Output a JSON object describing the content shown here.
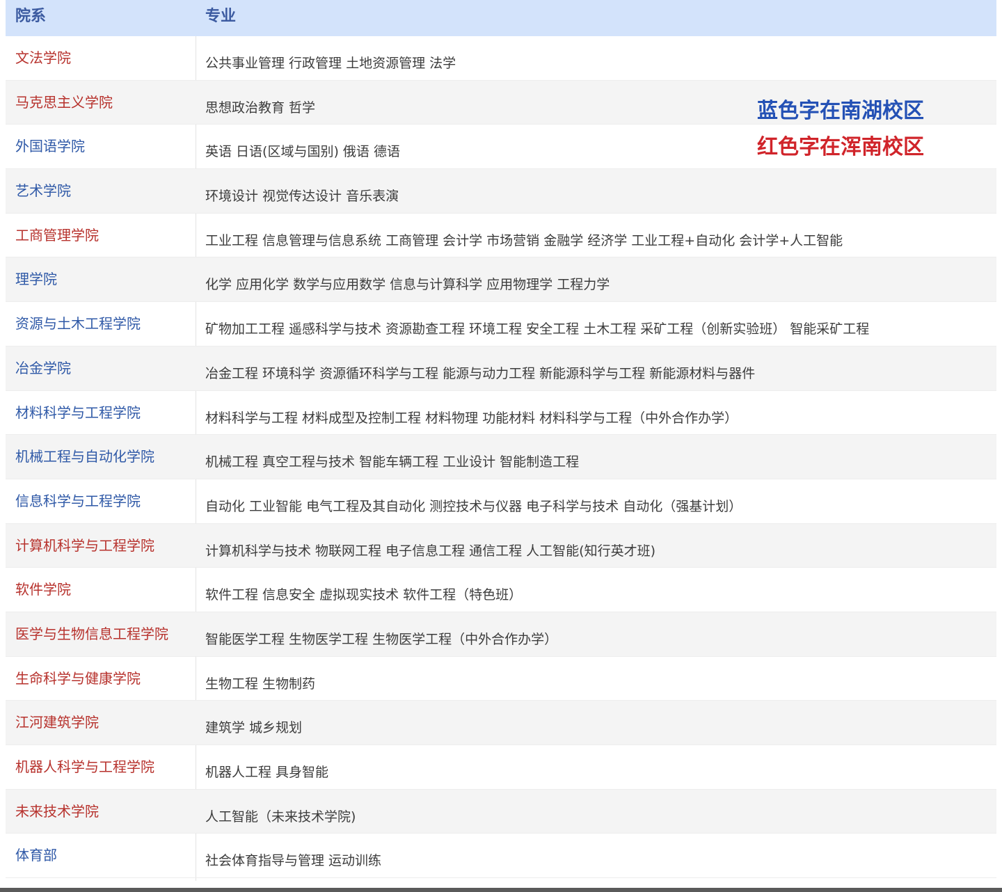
{
  "header": {
    "dept_label": "院系",
    "major_label": "专业"
  },
  "legend": {
    "blue_note": "蓝色字在南湖校区",
    "red_note": "红色字在浑南校区"
  },
  "colors": {
    "header_bg": "#d3e3fb",
    "red_campus": "#b7322d",
    "blue_campus": "#2f59a7"
  },
  "rows": [
    {
      "dept": "文法学院",
      "color": "red",
      "majors": "公共事业管理  行政管理  土地资源管理  法学"
    },
    {
      "dept": "马克思主义学院",
      "color": "red",
      "majors": "思想政治教育  哲学"
    },
    {
      "dept": "外国语学院",
      "color": "blue",
      "majors": "英语  日语(区域与国别)  俄语  德语"
    },
    {
      "dept": "艺术学院",
      "color": "blue",
      "majors": "环境设计  视觉传达设计  音乐表演"
    },
    {
      "dept": "工商管理学院",
      "color": "red",
      "majors": "工业工程  信息管理与信息系统  工商管理  会计学  市场营销  金融学  经济学  工业工程+自动化  会计学+人工智能"
    },
    {
      "dept": "理学院",
      "color": "blue",
      "majors": "化学  应用化学  数学与应用数学  信息与计算科学  应用物理学  工程力学"
    },
    {
      "dept": "资源与土木工程学院",
      "color": "blue",
      "majors": "矿物加工工程  遥感科学与技术  资源勘查工程  环境工程  安全工程  土木工程  采矿工程（创新实验班）   智能采矿工程"
    },
    {
      "dept": "冶金学院",
      "color": "blue",
      "majors": "冶金工程  环境科学  资源循环科学与工程  能源与动力工程  新能源科学与工程  新能源材料与器件"
    },
    {
      "dept": "材料科学与工程学院",
      "color": "blue",
      "majors": "材料科学与工程  材料成型及控制工程  材料物理  功能材料  材料科学与工程（中外合作办学）"
    },
    {
      "dept": "机械工程与自动化学院",
      "color": "blue",
      "majors": "机械工程  真空工程与技术  智能车辆工程  工业设计  智能制造工程"
    },
    {
      "dept": "信息科学与工程学院",
      "color": "blue",
      "majors": "自动化  工业智能  电气工程及其自动化  测控技术与仪器  电子科学与技术  自动化（强基计划）"
    },
    {
      "dept": "计算机科学与工程学院",
      "color": "red",
      "majors": "计算机科学与技术  物联网工程  电子信息工程  通信工程  人工智能(知行英才班)"
    },
    {
      "dept": "软件学院",
      "color": "red",
      "majors": "软件工程  信息安全  虚拟现实技术  软件工程（特色班）"
    },
    {
      "dept": "医学与生物信息工程学院",
      "color": "red",
      "majors": "智能医学工程  生物医学工程  生物医学工程（中外合作办学）"
    },
    {
      "dept": "生命科学与健康学院",
      "color": "red",
      "majors": "生物工程  生物制药"
    },
    {
      "dept": "江河建筑学院",
      "color": "red",
      "majors": "建筑学  城乡规划"
    },
    {
      "dept": "机器人科学与工程学院",
      "color": "red",
      "majors": "机器人工程  具身智能"
    },
    {
      "dept": "未来技术学院",
      "color": "red",
      "majors": "人工智能（未来技术学院)"
    },
    {
      "dept": "体育部",
      "color": "blue",
      "majors": "社会体育指导与管理  运动训练"
    }
  ]
}
